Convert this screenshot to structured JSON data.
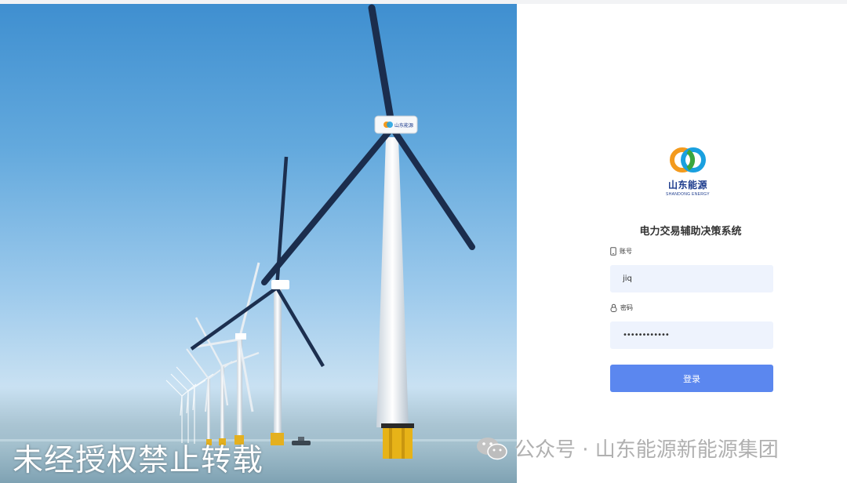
{
  "brand": {
    "logo_cn": "山东能源",
    "logo_en": "SHANDONG ENERGY",
    "turbine_badge": "山东能源"
  },
  "login": {
    "system_title": "电力交易辅助决策系统",
    "account_label": "账号",
    "account_value": "jiq",
    "password_label": "密码",
    "password_value": "••••••••••••",
    "login_button": "登录"
  },
  "watermarks": {
    "left": "未经授权禁止转载",
    "right": "公众号 · 山东能源新能源集团"
  },
  "colors": {
    "primary_button": "#5b87ef",
    "input_background": "#eef3fd",
    "logo_blue": "#1b3a8c",
    "logo_orange": "#f39a1d",
    "logo_green": "#3aa63f",
    "logo_lightblue": "#1aa0df"
  },
  "icons": {
    "account_icon": "phone-icon",
    "password_icon": "lock-icon",
    "wechat_icon": "wechat-icon"
  }
}
